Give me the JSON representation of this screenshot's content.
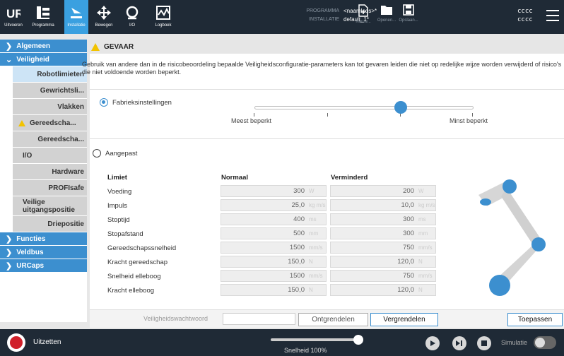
{
  "topbar": {
    "nav": [
      {
        "label": "Uitvoeren",
        "icon": "ur-logo-icon"
      },
      {
        "label": "Programma",
        "icon": "program-icon"
      },
      {
        "label": "Installatie",
        "icon": "installation-icon",
        "active": true
      },
      {
        "label": "Bewegen",
        "icon": "move-icon"
      },
      {
        "label": "I/O",
        "icon": "io-icon"
      },
      {
        "label": "Logboek",
        "icon": "log-icon"
      }
    ],
    "programma_label": "PROGRAMMA",
    "programma_value": "<naamloos>*",
    "installatie_label": "INSTALLATIE",
    "installatie_value": "default_1*",
    "file_buttons": [
      {
        "label": "Nieuw...",
        "icon": "new-file-icon"
      },
      {
        "label": "Openen...",
        "icon": "folder-icon"
      },
      {
        "label": "Opslaan...",
        "icon": "save-icon"
      }
    ],
    "user_line1": "cccc",
    "user_line2": "cccc"
  },
  "sidebar": {
    "categories": [
      {
        "label": "Algemeen",
        "expanded": false
      },
      {
        "label": "Veiligheid",
        "expanded": true
      },
      {
        "label": "Functies",
        "expanded": false
      },
      {
        "label": "Veldbus",
        "expanded": false
      },
      {
        "label": "URCaps",
        "expanded": false
      }
    ],
    "safety_items": [
      {
        "label": "Robotlimieten",
        "active": true
      },
      {
        "label": "Gewrichtsli..."
      },
      {
        "label": "Vlakken"
      },
      {
        "label": "Gereedscha...",
        "warning": true
      },
      {
        "label": "Gereedscha..."
      },
      {
        "label": "I/O"
      },
      {
        "label": "Hardware"
      },
      {
        "label": "PROFIsafe"
      },
      {
        "label": "Veilige uitgangspositie"
      },
      {
        "label": "Driepositie"
      }
    ]
  },
  "main": {
    "warning_title": "GEVAAR",
    "warning_text": "Gebruik van andere dan in de risicobeoordeling bepaalde Veiligheidsconfiguratie-parameters kan tot gevaren leiden die niet op redelijke wijze worden verwijderd of risico's die niet voldoende worden beperkt.",
    "factory_label": "Fabrieksinstellingen",
    "slider_min_label": "Meest beperkt",
    "slider_max_label": "Minst beperkt",
    "slider_position": 0.67,
    "custom_label": "Aangepast",
    "table": {
      "headers": {
        "limit": "Limiet",
        "normal": "Normaal",
        "reduced": "Verminderd"
      },
      "rows": [
        {
          "label": "Voeding",
          "normal": "300",
          "reduced": "200",
          "unit": "W"
        },
        {
          "label": "Impuls",
          "normal": "25,0",
          "reduced": "10,0",
          "unit": "kg m/s"
        },
        {
          "label": "Stoptijd",
          "normal": "400",
          "reduced": "300",
          "unit": "ms"
        },
        {
          "label": "Stopafstand",
          "normal": "500",
          "reduced": "300",
          "unit": "mm"
        },
        {
          "label": "Gereedschapssnelheid",
          "normal": "1500",
          "reduced": "750",
          "unit": "mm/s"
        },
        {
          "label": "Kracht gereedschap",
          "normal": "150,0",
          "reduced": "120,0",
          "unit": "N"
        },
        {
          "label": "Snelheid elleboog",
          "normal": "1500",
          "reduced": "750",
          "unit": "mm/s"
        },
        {
          "label": "Kracht elleboog",
          "normal": "150,0",
          "reduced": "120,0",
          "unit": "N"
        }
      ]
    }
  },
  "password_bar": {
    "label": "Veiligheidswachtwoord",
    "unlock": "Ontgrendelen",
    "lock": "Vergrendelen",
    "apply": "Toepassen"
  },
  "bottombar": {
    "power_label": "Uitzetten",
    "speed_label": "Snelheid 100%",
    "speed_value": 1.0,
    "sim_label": "Simulatie"
  },
  "colors": {
    "accent": "#3c8fcf",
    "topbar": "#1f2a36",
    "warning": "#f2c300",
    "power": "#d0202a"
  }
}
